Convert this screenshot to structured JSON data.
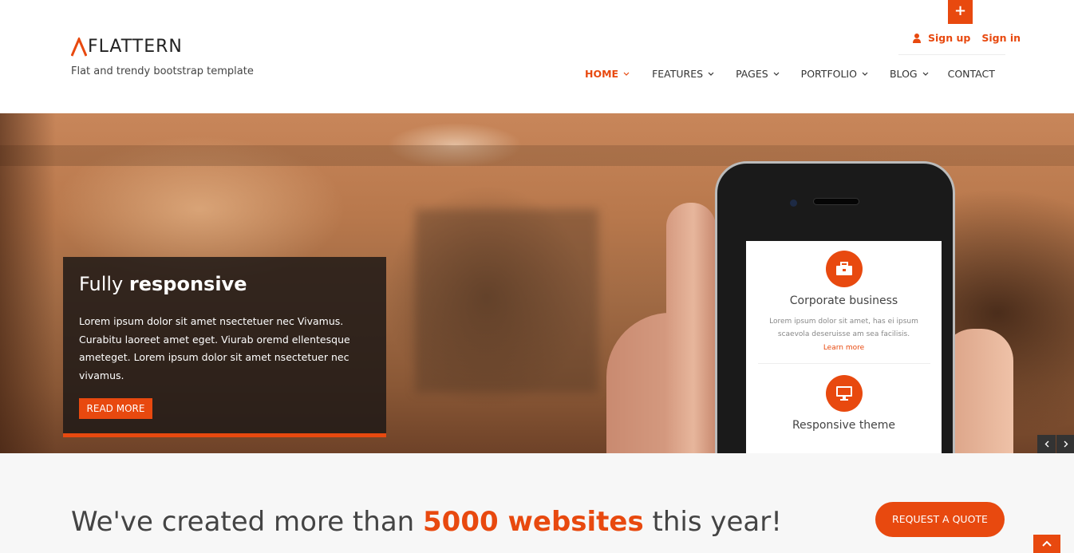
{
  "colors": {
    "accent": "#e8490f",
    "dark_text": "#444444",
    "caption_bg": "#1e1916"
  },
  "topbar": {
    "plus_icon": "+"
  },
  "brand": {
    "name": "FLATTERN",
    "tagline": "Flat and trendy bootstrap template"
  },
  "user_links": {
    "signup": "Sign up",
    "signin": "Sign in"
  },
  "nav": {
    "items": [
      {
        "label": "HOME",
        "active": true,
        "dropdown": true
      },
      {
        "label": "FEATURES",
        "active": false,
        "dropdown": true
      },
      {
        "label": "PAGES",
        "active": false,
        "dropdown": true
      },
      {
        "label": "PORTFOLIO",
        "active": false,
        "dropdown": true
      },
      {
        "label": "BLOG",
        "active": false,
        "dropdown": true
      },
      {
        "label": "CONTACT",
        "active": false,
        "dropdown": false
      }
    ]
  },
  "hero": {
    "caption": {
      "title_regular": "Fully",
      "title_bold": "responsive",
      "text": "Lorem ipsum dolor sit amet nsectetuer nec Vivamus. Curabitu laoreet amet eget. Viurab oremd ellentesque ameteget. Lorem ipsum dolor sit amet nsectetuer nec vivamus.",
      "button": "READ MORE"
    },
    "phone_features": [
      {
        "icon": "briefcase-icon",
        "title": "Corporate business",
        "text": "Lorem ipsum dolor sit amet, has ei ipsum scaevola deseruisse am sea facilisis.",
        "link": "Learn more"
      },
      {
        "icon": "monitor-icon",
        "title": "Responsive theme"
      }
    ]
  },
  "strip": {
    "headline_before": "We've created more than",
    "headline_accent": "5000 websites",
    "headline_after": "this year!",
    "quote_button": "REQUEST A QUOTE"
  }
}
